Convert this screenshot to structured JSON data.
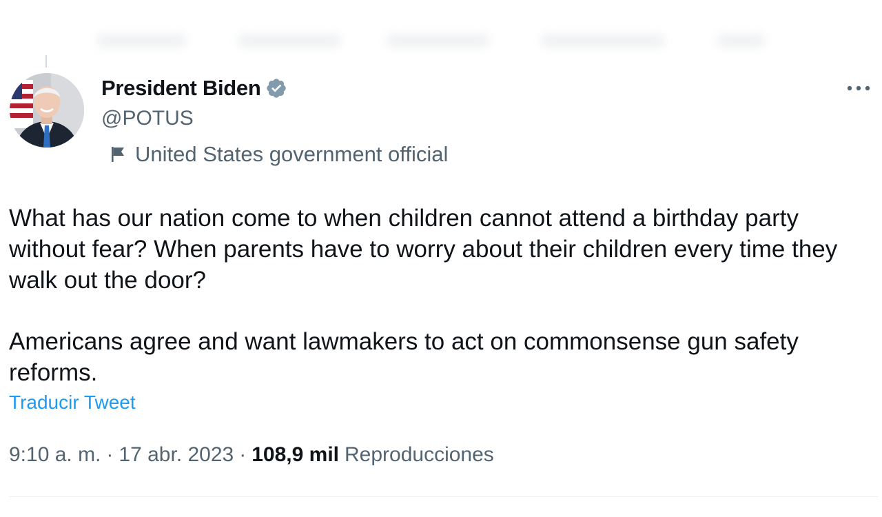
{
  "tweet": {
    "author": {
      "name": "President Biden",
      "handle": "@POTUS",
      "label": "United States government official"
    },
    "text_paragraph_1": "What has our nation come to when children cannot attend a birthday party without fear? When parents have to worry about their children every time they walk out the door?",
    "text_paragraph_2": "Americans agree and want lawmakers to act on commonsense gun safety reforms.",
    "translate_label": "Traducir Tweet",
    "time": "9:10 a. m.",
    "separator": "·",
    "date": "17 abr. 2023",
    "views_count": "108,9 mil",
    "views_label": "Reproducciones",
    "more_icon": "more-horizontal-icon",
    "verified_icon": "verified-badge-icon",
    "label_icon": "flag-icon"
  },
  "colors": {
    "text_primary": "#0f1419",
    "text_secondary": "#536471",
    "link": "#1d9bf0",
    "verified_gray": "#829aab",
    "divider": "#eff3f4"
  }
}
